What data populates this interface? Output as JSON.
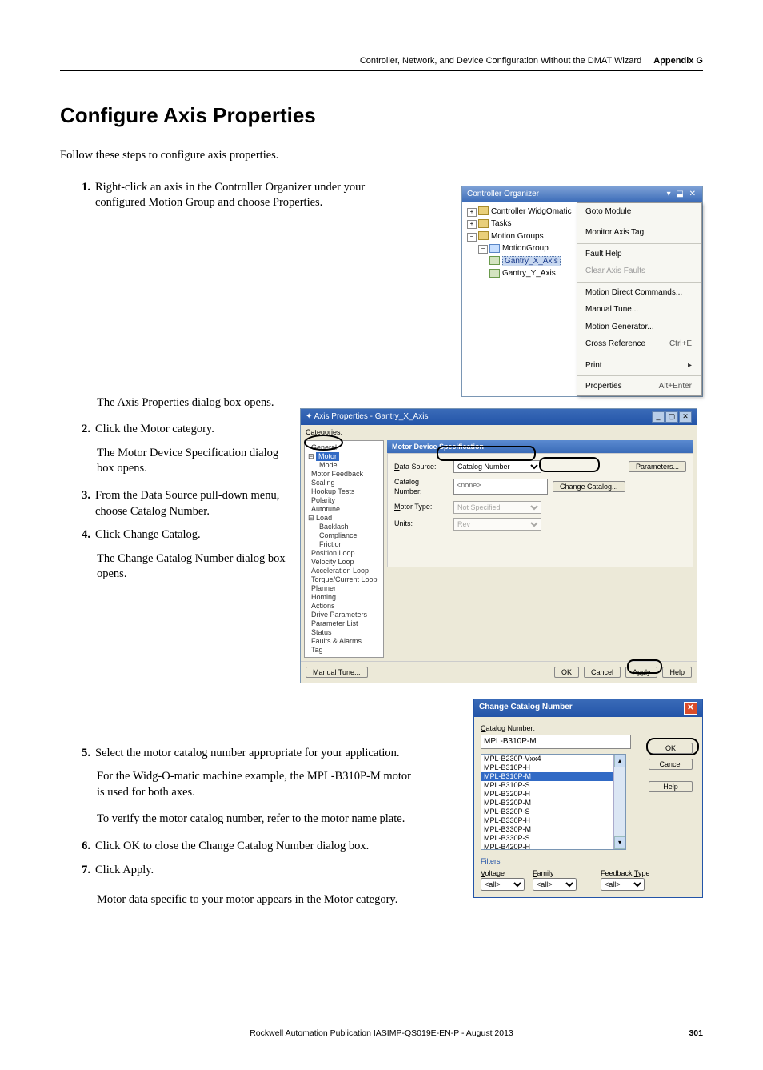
{
  "header": {
    "chapter": "Controller, Network, and Device Configuration Without the DMAT Wizard",
    "appendix": "Appendix G"
  },
  "h1": "Configure Axis Properties",
  "intro": "Follow these steps to configure axis properties.",
  "steps": {
    "s1n": "1.",
    "s1": "Right-click an axis in the Controller Organizer under your configured Motion Group and choose Properties.",
    "s1sub": "The Axis Properties dialog box opens.",
    "s2n": "2.",
    "s2": "Click the Motor category.",
    "s2sub": "The Motor Device Specification dialog box opens.",
    "s3n": "3.",
    "s3": "From the Data Source pull-down menu, choose Catalog Number.",
    "s4n": "4.",
    "s4": "Click Change Catalog.",
    "s4sub": "The Change Catalog Number dialog box opens.",
    "s5n": "5.",
    "s5": "Select the motor catalog number appropriate for your application.",
    "s5sub1": "For the Widg-O-matic machine example, the MPL-B310P-M motor is used for both axes.",
    "s5sub2": "To verify the motor catalog number, refer to the motor name plate.",
    "s6n": "6.",
    "s6": "Click OK to close the Change Catalog Number dialog box.",
    "s7n": "7.",
    "s7": "Click Apply.",
    "s7sub": "Motor data specific to your motor appears in the Motor category."
  },
  "controllerOrganizer": {
    "title": "Controller Organizer",
    "winbtns": "▾ ⬓ ✕",
    "items": {
      "controller": "Controller WidgOmatic",
      "tasks": "Tasks",
      "motionGroups": "Motion Groups",
      "motionGroup": "MotionGroup",
      "gx": "Gantry_X_Axis",
      "gy": "Gantry_Y_Axis"
    }
  },
  "contextMenu": {
    "goto": "Goto Module",
    "monitor": "Monitor Axis Tag",
    "fault": "Fault Help",
    "clear": "Clear Axis Faults",
    "mdc": "Motion Direct Commands...",
    "mtune": "Manual Tune...",
    "mgen": "Motion Generator...",
    "xref": "Cross Reference",
    "xref_k": "Ctrl+E",
    "print": "Print",
    "props": "Properties",
    "props_k": "Alt+Enter"
  },
  "axisProps": {
    "title": "Axis Properties - Gantry_X_Axis",
    "catLabel": "Categories:",
    "tree": {
      "general": "General",
      "motor": "Motor",
      "model": "Model",
      "mfb": "Motor Feedback",
      "scaling": "Scaling",
      "hookup": "Hookup Tests",
      "polarity": "Polarity",
      "autotune": "Autotune",
      "load": "Load",
      "backlash": "Backlash",
      "compliance": "Compliance",
      "friction": "Friction",
      "pos": "Position Loop",
      "vel": "Velocity Loop",
      "acc": "Acceleration Loop",
      "torque": "Torque/Current Loop",
      "planner": "Planner",
      "homing": "Homing",
      "actions": "Actions",
      "drive": "Drive Parameters",
      "plist": "Parameter List",
      "status": "Status",
      "faults": "Faults & Alarms",
      "tag": "Tag"
    },
    "sectionTitle": "Motor Device Specification",
    "form": {
      "dsLabel": "Data Source:",
      "dsValue": "Catalog Number",
      "catLabel": "Catalog Number:",
      "catValue": "<none>",
      "mtLabel": "Motor Type:",
      "mtValue": "Not Specified",
      "unitsLabel": "Units:",
      "unitsValue": "Rev",
      "params": "Parameters...",
      "change": "Change Catalog..."
    },
    "buttons": {
      "mt": "Manual Tune...",
      "ok": "OK",
      "cancel": "Cancel",
      "apply": "Apply",
      "help": "Help"
    }
  },
  "catalogDlg": {
    "title": "Change Catalog Number",
    "label": "Catalog Number:",
    "value": "MPL-B310P-M",
    "list": [
      "MPL-B230P-Vxx4",
      "MPL-B310P-H",
      "MPL-B310P-M",
      "MPL-B310P-S",
      "MPL-B320P-H",
      "MPL-B320P-M",
      "MPL-B320P-S",
      "MPL-B330P-H",
      "MPL-B330P-M",
      "MPL-B330P-S",
      "MPL-B420P-H"
    ],
    "ok": "OK",
    "cancel": "Cancel",
    "help": "Help",
    "filtersLabel": "Filters",
    "voltage": "Voltage",
    "family": "Family",
    "fbtype": "Feedback Type",
    "all": "<all>"
  },
  "footer": {
    "text": "Rockwell Automation Publication IASIMP-QS019E-EN-P - August 2013",
    "page": "301"
  }
}
